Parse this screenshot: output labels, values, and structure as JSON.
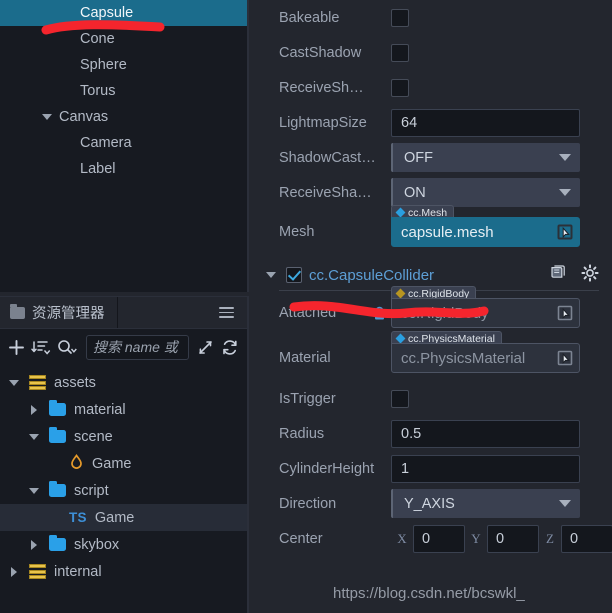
{
  "hierarchy": {
    "items": [
      {
        "label": "Capsule",
        "indent": 2,
        "selected": true,
        "caret": "none"
      },
      {
        "label": "Cone",
        "indent": 2,
        "selected": false,
        "caret": "none"
      },
      {
        "label": "Sphere",
        "indent": 2,
        "selected": false,
        "caret": "none"
      },
      {
        "label": "Torus",
        "indent": 2,
        "selected": false,
        "caret": "none"
      },
      {
        "label": "Canvas",
        "indent": 1,
        "selected": false,
        "caret": "expanded"
      },
      {
        "label": "Camera",
        "indent": 2,
        "selected": false,
        "caret": "none"
      },
      {
        "label": "Label",
        "indent": 2,
        "selected": false,
        "caret": "none"
      }
    ]
  },
  "assets": {
    "tab_label": "资源管理器",
    "tab_icon": "folder-icon",
    "menu_icon": "hamburger-icon",
    "toolbar": {
      "add_icon": "plus-icon",
      "sort_icon": "sort-icon",
      "filter_icon": "search-filter-icon",
      "collapse_icon": "collapse-arrows-icon",
      "refresh_icon": "refresh-icon"
    },
    "search": {
      "value": "",
      "placeholder": "搜索 name 或 ur"
    },
    "tree": [
      {
        "label": "assets",
        "indent": 0,
        "caret": "expanded",
        "icon": "database-icon",
        "selected": false
      },
      {
        "label": "material",
        "indent": 1,
        "caret": "collapsed",
        "icon": "folder-icon",
        "selected": false
      },
      {
        "label": "scene",
        "indent": 1,
        "caret": "expanded",
        "icon": "folder-icon",
        "selected": false
      },
      {
        "label": "Game",
        "indent": 2,
        "caret": "none",
        "icon": "flame-icon",
        "selected": false
      },
      {
        "label": "script",
        "indent": 1,
        "caret": "expanded",
        "icon": "folder-icon",
        "selected": false
      },
      {
        "label": "Game",
        "indent": 2,
        "caret": "none",
        "icon": "ts-icon",
        "selected": true
      },
      {
        "label": "skybox",
        "indent": 1,
        "caret": "collapsed",
        "icon": "folder-icon",
        "selected": false
      },
      {
        "label": "internal",
        "indent": 0,
        "caret": "collapsed",
        "icon": "database-icon",
        "selected": false
      }
    ]
  },
  "inspector": {
    "renderer_props": [
      {
        "label": "Bakeable",
        "type": "checkbox",
        "value": false
      },
      {
        "label": "CastShadow",
        "type": "checkbox",
        "value": false
      },
      {
        "label": "ReceiveSh…",
        "type": "checkbox",
        "value": false
      },
      {
        "label": "LightmapSize",
        "type": "number",
        "value": "64"
      },
      {
        "label": "ShadowCast…",
        "type": "select",
        "value": "OFF"
      },
      {
        "label": "ReceiveSha…",
        "type": "select",
        "value": "ON"
      }
    ],
    "mesh": {
      "label": "Mesh",
      "badge": "cc.Mesh",
      "value": "capsule.mesh",
      "pick_icon": "asset-picker-icon"
    },
    "collider": {
      "enabled": true,
      "title": "cc.CapsuleCollider",
      "help_icon": "book-icon",
      "settings_icon": "gear-icon",
      "attached": {
        "label": "Attached",
        "lock_icon": "lock-icon",
        "badge": "cc.RigidBody",
        "value": "cc.RigidBody",
        "pick_icon": "asset-picker-icon"
      },
      "material": {
        "label": "Material",
        "badge": "cc.PhysicsMaterial",
        "value": "cc.PhysicsMaterial",
        "pick_icon": "asset-picker-icon"
      },
      "is_trigger": {
        "label": "IsTrigger",
        "value": false
      },
      "radius": {
        "label": "Radius",
        "value": "0.5"
      },
      "cylinder_height": {
        "label": "CylinderHeight",
        "value": "1"
      },
      "direction": {
        "label": "Direction",
        "value": "Y_AXIS"
      },
      "center": {
        "label": "Center",
        "x_label": "X",
        "x": "0",
        "y_label": "Y",
        "y": "0",
        "z_label": "Z",
        "z": "0"
      }
    }
  },
  "watermark": "https://blog.csdn.net/bcswkl_",
  "colors": {
    "selection": "#1b6c8c",
    "annotation": "#f5252d",
    "component_title": "#5d9fd6",
    "panel_bg": "#171a21",
    "inspector_bg": "#23262e"
  }
}
